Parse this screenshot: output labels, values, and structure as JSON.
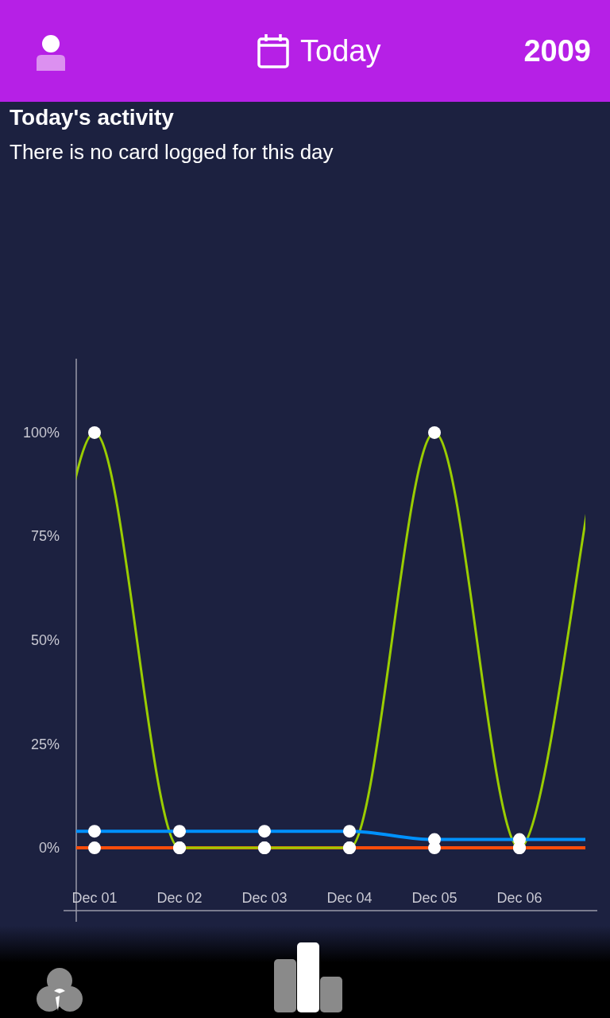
{
  "header": {
    "title": "Today",
    "year": "2009"
  },
  "activity": {
    "heading": "Today's activity",
    "message": "There is no card logged for this day"
  },
  "chart": {
    "chart_data": {
      "type": "line",
      "categories": [
        "Dec 01",
        "Dec 02",
        "Dec 03",
        "Dec 04",
        "Dec 05",
        "Dec 06"
      ],
      "ylim": [
        -17.8,
        117.8
      ],
      "yticks": [
        {
          "value": 0,
          "label": "0%"
        },
        {
          "value": 25,
          "label": "25%"
        },
        {
          "value": 50,
          "label": "50%"
        },
        {
          "value": 75,
          "label": "75%"
        },
        {
          "value": 100,
          "label": "100%"
        }
      ],
      "series": [
        {
          "color": "#ff4d0a",
          "marker": "circle",
          "values": [
            0,
            0,
            0,
            0,
            0,
            0
          ]
        },
        {
          "color": "#9acd00",
          "marker": "circle",
          "values": [
            100,
            0,
            0,
            0,
            100,
            0
          ]
        },
        {
          "color": "#0091ff",
          "marker": "circle",
          "values": [
            4,
            4,
            4,
            4,
            2,
            2
          ]
        }
      ]
    }
  },
  "bottom_nav": [
    {
      "kind": "circles"
    },
    {
      "kind": "bars"
    }
  ]
}
